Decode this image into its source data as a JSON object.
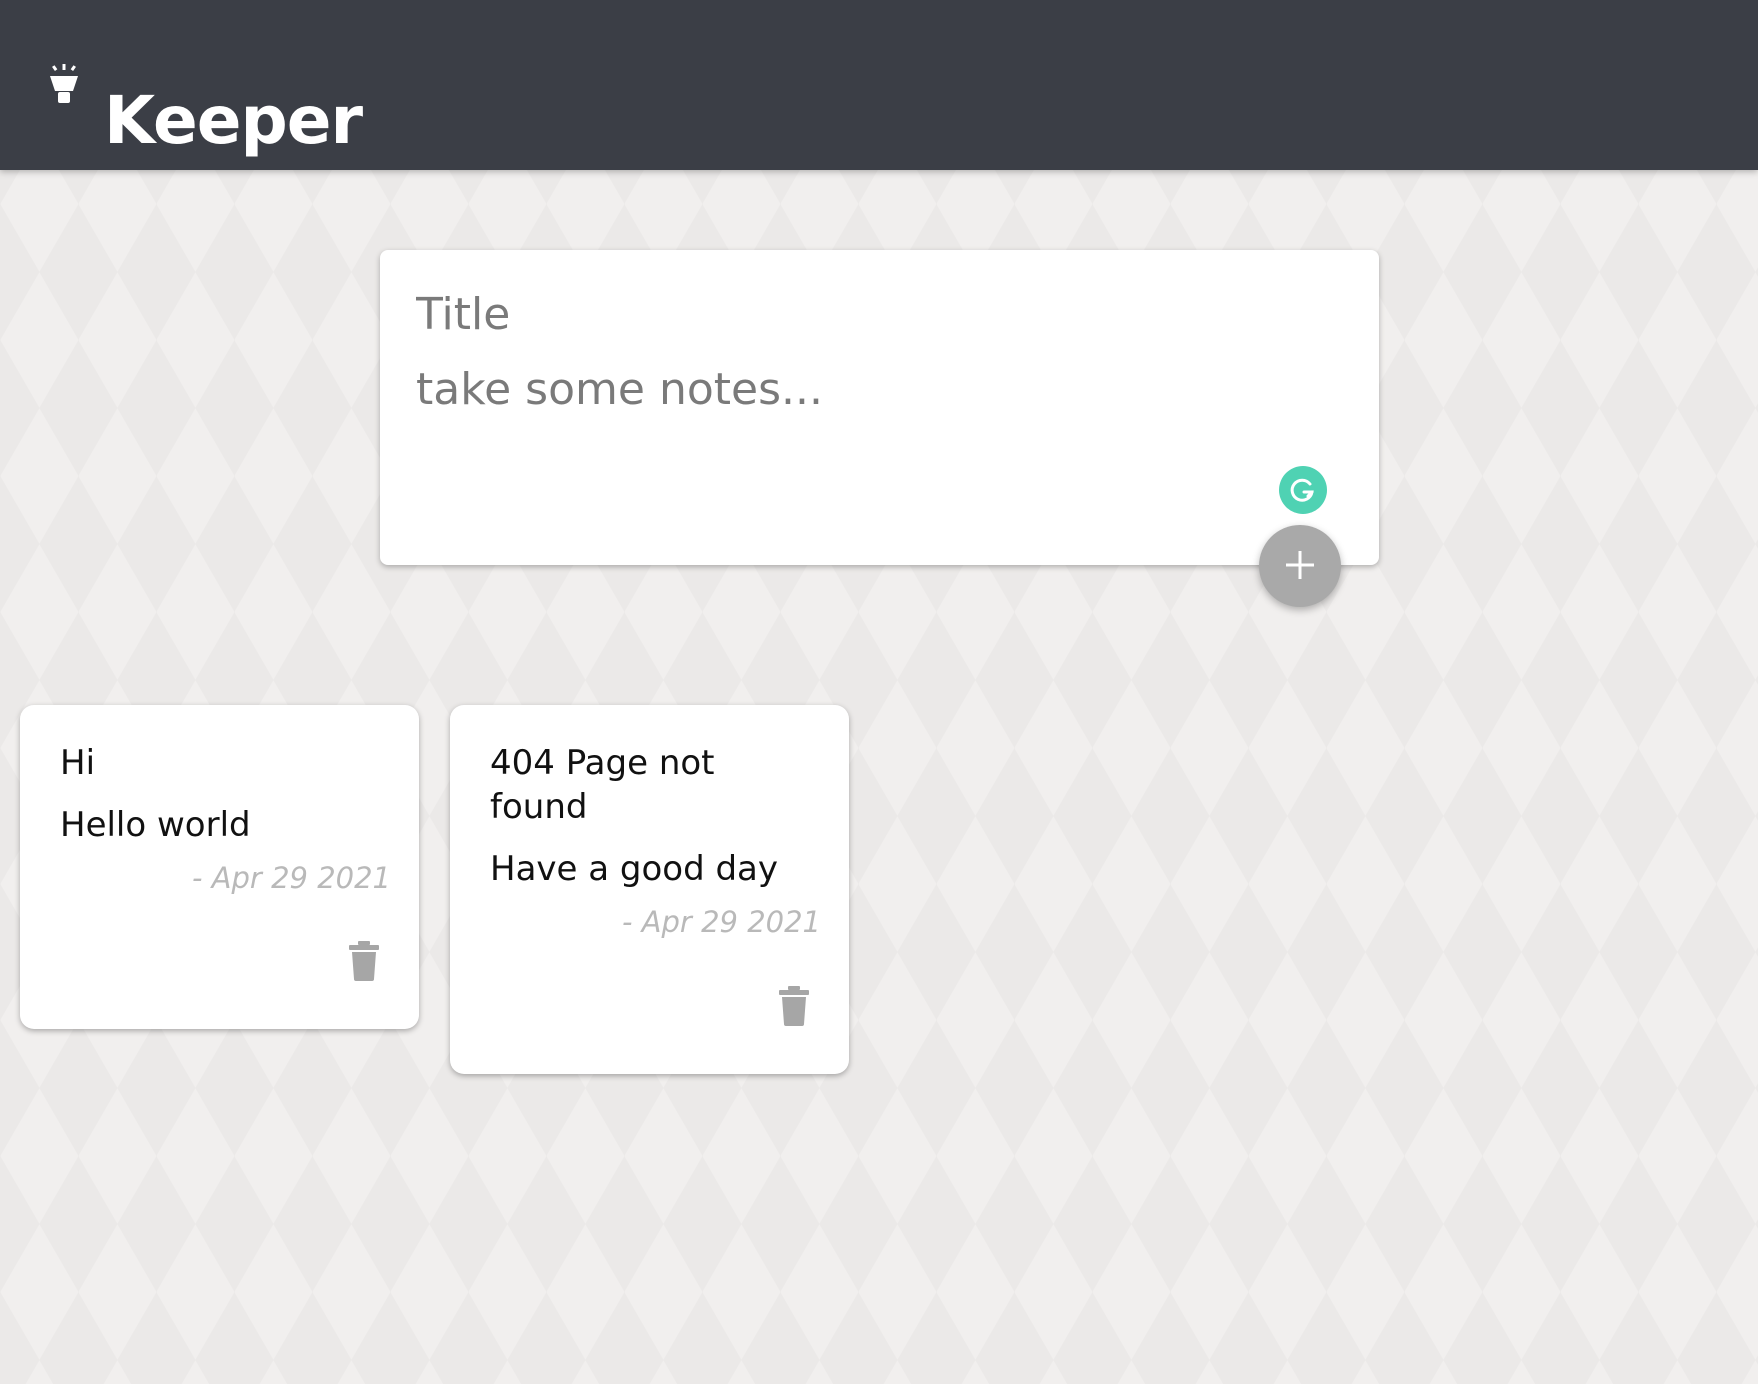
{
  "app": {
    "title": "Keeper"
  },
  "compose": {
    "title_placeholder": "Title",
    "content_placeholder": "take some notes...",
    "add_label": "+"
  },
  "notes": [
    {
      "title": "Hi",
      "content": "Hello world",
      "date": "- Apr 29 2021"
    },
    {
      "title": "404 Page not found",
      "content": "Have a good day",
      "date": "- Apr 29 2021"
    }
  ],
  "colors": {
    "header_bg": "#3b3e46",
    "page_bg": "#f1efee",
    "add_button": "#a9a9a9",
    "grammarly": "#15c39a",
    "date_text": "#b9b9b9"
  },
  "icons": {
    "logo": "lightbulb-icon",
    "add": "plus-icon",
    "delete": "trash-icon",
    "grammarly": "grammarly-icon"
  }
}
